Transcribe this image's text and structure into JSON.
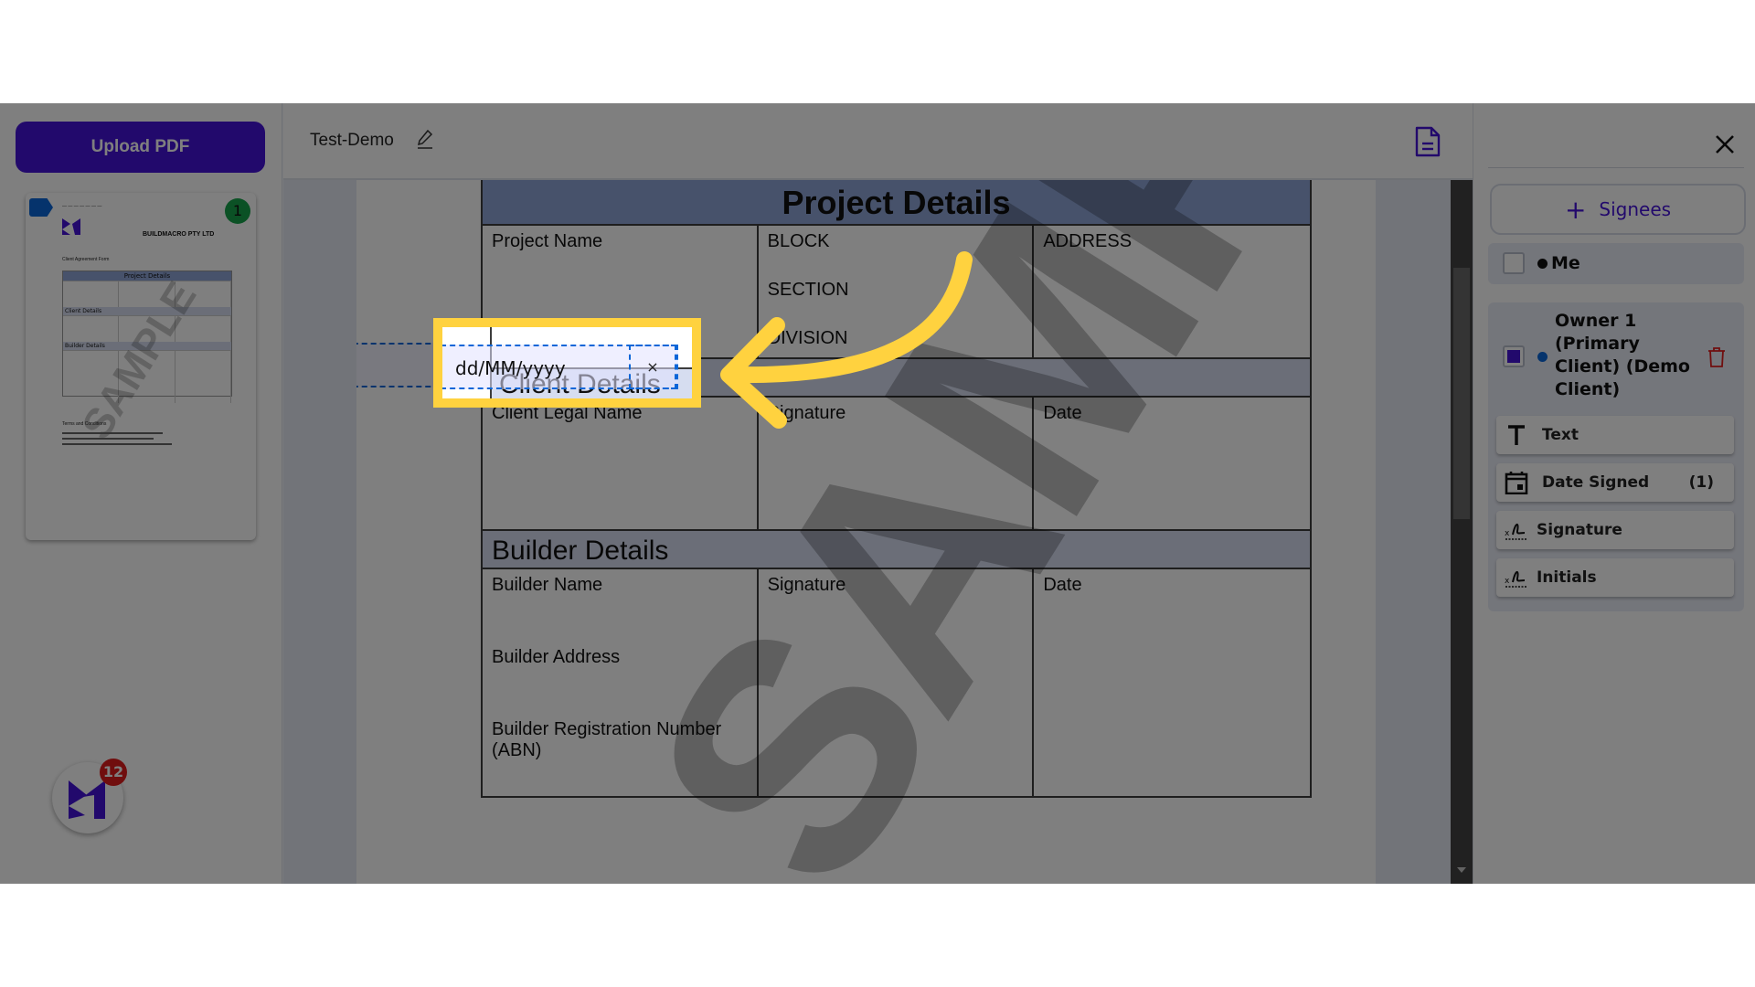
{
  "left_panel": {
    "upload_label": "Upload PDF",
    "thumbnail": {
      "page_number": "1",
      "company": "BUILDMACRO PTY LTD",
      "form_title": "Client Agreement Form",
      "project_header": "Project Details",
      "client_header": "Client Details",
      "builder_header": "Builder Details",
      "terms_header": "Terms and Conditions",
      "watermark": "SAMPLE"
    },
    "app_badge": {
      "count": "12"
    }
  },
  "header": {
    "title": "Test-Demo"
  },
  "document": {
    "watermark": "SAMPLE",
    "project": {
      "title": "Project Details",
      "col1": [
        "Project Name"
      ],
      "col2": [
        "BLOCK",
        "SECTION",
        "DIVISION"
      ],
      "col3": [
        "ADDRESS"
      ]
    },
    "client": {
      "title": "Client Details",
      "col1": [
        "Client Legal Name"
      ],
      "col2": [
        "Signature"
      ],
      "col3": [
        "Date"
      ]
    },
    "builder": {
      "title": "Builder Details",
      "col1": [
        "Builder Name",
        "Builder Address",
        "Builder Registration Number (ABN)"
      ],
      "col2": [
        "Signature"
      ],
      "col3": [
        "Date"
      ]
    },
    "date_field": {
      "value": "dd/MM/yyyy",
      "clear_label": "×"
    }
  },
  "right_panel": {
    "signees_label": "Signees",
    "signees": [
      {
        "name": "Me",
        "checked": false,
        "dot_color": "#111111"
      },
      {
        "name": "Owner 1 (Primary Client) (Demo Client)",
        "name_lines": [
          "Owner 1",
          "(Primary",
          "Client) (Demo",
          "Client)"
        ],
        "checked": true,
        "dot_color": "#0a66d8"
      }
    ],
    "fields": [
      {
        "label": "Text",
        "icon": "text-icon",
        "count": ""
      },
      {
        "label": "Date Signed",
        "icon": "calendar-icon",
        "count": "(1)"
      },
      {
        "label": "Signature",
        "icon": "signature-icon",
        "count": ""
      },
      {
        "label": "Initials",
        "icon": "initials-icon",
        "count": ""
      }
    ]
  },
  "colors": {
    "accent": "#4513d8",
    "highlight": "#ffd23f",
    "field_blue": "#0a66d8",
    "danger": "#e11d1d",
    "success": "#16a34a"
  }
}
